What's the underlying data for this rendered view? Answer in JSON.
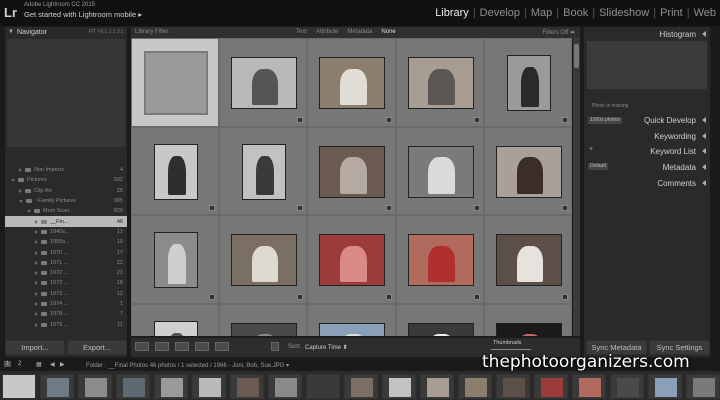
{
  "app": {
    "logo": "Lr",
    "title": "Adobe Lightroom CC 2015",
    "subtitle": "Get started with Lightroom mobile",
    "subtitle_arrow": "▸"
  },
  "modules": {
    "library": "Library",
    "develop": "Develop",
    "map": "Map",
    "book": "Book",
    "slideshow": "Slideshow",
    "print": "Print",
    "web": "Web",
    "separator": "|"
  },
  "left_panel": {
    "navigator_title": "Navigator",
    "navigator_modes": "FIT  FILL  1:1  3:1",
    "folders": [
      {
        "label": "Non Imports",
        "count": "4",
        "level": 1,
        "expanded": false
      },
      {
        "label": "Pictures",
        "count": "932",
        "level": 0,
        "expanded": true
      },
      {
        "label": "Clip Art",
        "count": "25",
        "level": 1,
        "expanded": false
      },
      {
        "label": "~Family Pictures",
        "count": "905",
        "level": 1,
        "expanded": true
      },
      {
        "label": "Mom Scan...",
        "count": "820",
        "level": 2,
        "expanded": true
      },
      {
        "label": "__Fin...",
        "count": "46",
        "level": 3,
        "expanded": false,
        "selected": true
      },
      {
        "label": "1940s...",
        "count": "12",
        "level": 3
      },
      {
        "label": "1950s...",
        "count": "10",
        "level": 3
      },
      {
        "label": "1970 ...",
        "count": "17",
        "level": 3
      },
      {
        "label": "1971 ...",
        "count": "22",
        "level": 3
      },
      {
        "label": "1972 ...",
        "count": "23",
        "level": 3
      },
      {
        "label": "1972 ...",
        "count": "18",
        "level": 3
      },
      {
        "label": "1973 ...",
        "count": "12",
        "level": 3
      },
      {
        "label": "1974 ...",
        "count": "1",
        "level": 3
      },
      {
        "label": "1978 ...",
        "count": "7",
        "level": 3
      },
      {
        "label": "1979 ...",
        "count": "11",
        "level": 3
      }
    ],
    "import_label": "Import...",
    "export_label": "Export..."
  },
  "filter_bar": {
    "title": "Library Filter :",
    "options": [
      "Text",
      "Attribute",
      "Metadata",
      "None"
    ],
    "active": "None",
    "filters_off": "Filters Off ⬌"
  },
  "grid": {
    "cells": [
      {
        "type": "empty",
        "selected": true
      },
      {
        "type": "bw",
        "tone": "#b9b9b9",
        "subject": "#555"
      },
      {
        "type": "color",
        "tone": "#8c7e6c",
        "subject": "#e0ddd7"
      },
      {
        "type": "color",
        "tone": "#a79d93",
        "subject": "#5a5754"
      },
      {
        "type": "bw",
        "tone": "#9a9a9a",
        "subject": "#2a2a2a"
      },
      {
        "type": "bw",
        "tone": "#c8c8c8",
        "subject": "#2e2e2e"
      },
      {
        "type": "bw",
        "tone": "#c2c2c2",
        "subject": "#3a3a3a"
      },
      {
        "type": "color",
        "tone": "#6b5a52",
        "subject": "#b5aaa2"
      },
      {
        "type": "bw",
        "tone": "#7a7a7a",
        "subject": "#dadada"
      },
      {
        "type": "color",
        "tone": "#a8a099",
        "subject": "#3a2d2a"
      },
      {
        "type": "bw",
        "tone": "#8b8b8b",
        "subject": "#cfcfcf"
      },
      {
        "type": "color",
        "tone": "#7b6e62",
        "subject": "#ddd8d0"
      },
      {
        "type": "color",
        "tone": "#9b3b3a",
        "subject": "#d98a88"
      },
      {
        "type": "color",
        "tone": "#b06a5e",
        "subject": "#b02f2f"
      },
      {
        "type": "color",
        "tone": "#5c4f48",
        "subject": "#e6e3df"
      },
      {
        "type": "bw",
        "tone": "#cfcfcf",
        "subject": "#555"
      },
      {
        "type": "color",
        "tone": "#4a4a4a",
        "subject": "#888"
      },
      {
        "type": "color",
        "tone": "#8aa0b8",
        "subject": "#ddd"
      },
      {
        "type": "bw",
        "tone": "#3a3a3a",
        "subject": "#eee"
      },
      {
        "type": "color",
        "tone": "#1a1a1a",
        "subject": "#cc6666"
      }
    ]
  },
  "toolbar": {
    "sort_label": "Sort:",
    "sort_value": "Capture Time ⬍",
    "thumbnails_label": "Thumbnails"
  },
  "right_panel": {
    "histogram": "Histogram",
    "photo_missing": "Photo is missing",
    "saved_preset": "1000s photos",
    "quick_develop": "Quick Develop",
    "keywording": "Keywording",
    "keyword_list": "Keyword List",
    "metadata": "Metadata",
    "metadata_preset": "Default",
    "comments": "Comments",
    "plus": "+",
    "sync_metadata": "Sync Metadata",
    "sync_settings": "Sync Settings"
  },
  "filmstrip": {
    "num1": "1",
    "num2": "2",
    "path": "Folder : __Final Photos    46 photos / 1 selected / 1966 - Joni, Bob, Sue.JPG ▾"
  },
  "watermark": "thephotoorganizers.com"
}
